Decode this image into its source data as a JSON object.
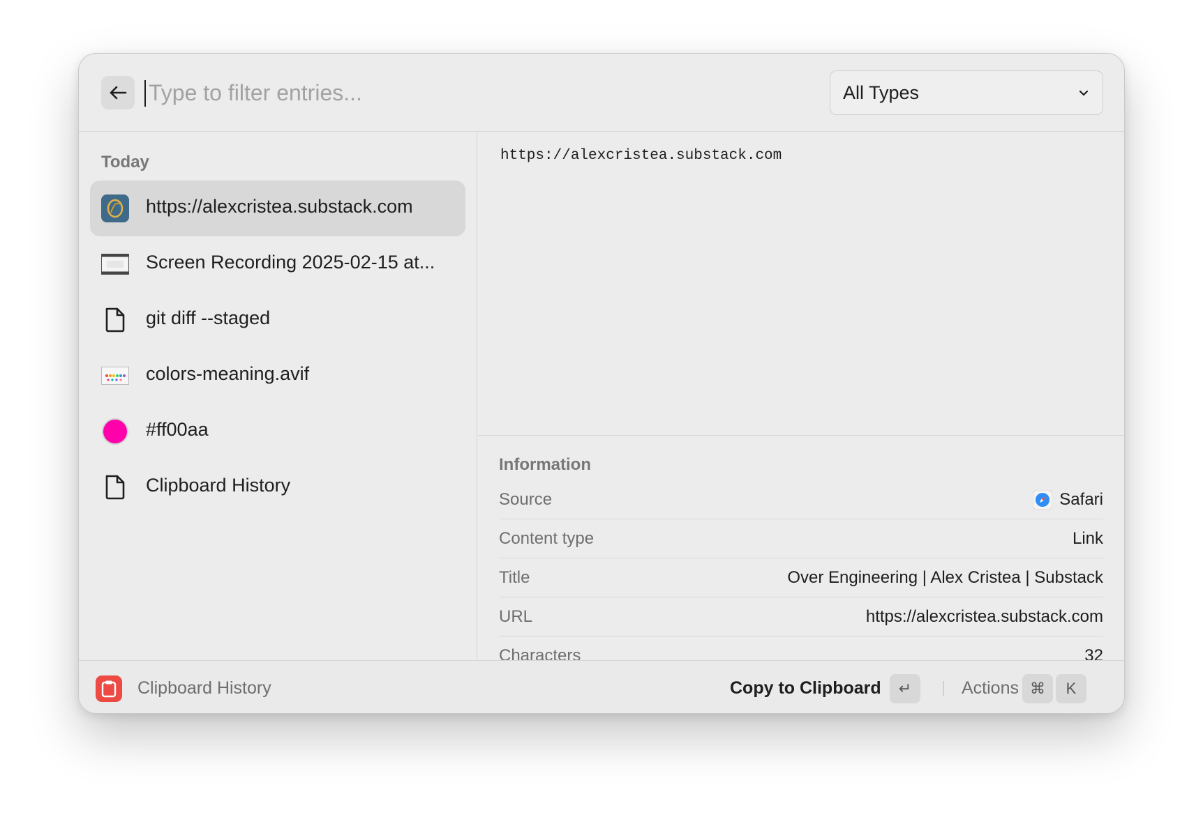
{
  "search": {
    "placeholder": "Type to filter entries..."
  },
  "type_filter": {
    "selected": "All Types"
  },
  "list": {
    "section_title": "Today",
    "items": [
      {
        "label": "https://alexcristea.substack.com",
        "icon": "substack-favicon-icon",
        "selected": true
      },
      {
        "label": "Screen Recording 2025-02-15 at...",
        "icon": "video-thumbnail-icon"
      },
      {
        "label": "git diff --staged",
        "icon": "document-icon"
      },
      {
        "label": "colors-meaning.avif",
        "icon": "image-thumbnail-icon"
      },
      {
        "label": "#ff00aa",
        "icon": "color-swatch-icon",
        "color": "#ff00aa"
      },
      {
        "label": "Clipboard History",
        "icon": "document-icon"
      }
    ]
  },
  "preview": {
    "text": "https://alexcristea.substack.com"
  },
  "info": {
    "title": "Information",
    "rows": [
      {
        "key": "Source",
        "value": "Safari",
        "icon": "safari-icon"
      },
      {
        "key": "Content type",
        "value": "Link"
      },
      {
        "key": "Title",
        "value": "Over Engineering | Alex Cristea | Substack"
      },
      {
        "key": "URL",
        "value": "https://alexcristea.substack.com"
      },
      {
        "key": "Characters",
        "value": "32"
      }
    ]
  },
  "footer": {
    "app_name": "Clipboard History",
    "primary_action": "Copy to Clipboard",
    "primary_key": "↵",
    "actions_label": "Actions",
    "actions_keys": [
      "⌘",
      "K"
    ]
  },
  "colors": {
    "accent_red": "#ec4a43",
    "selection": "#d8d8d8",
    "swatch": "#ff00aa"
  }
}
